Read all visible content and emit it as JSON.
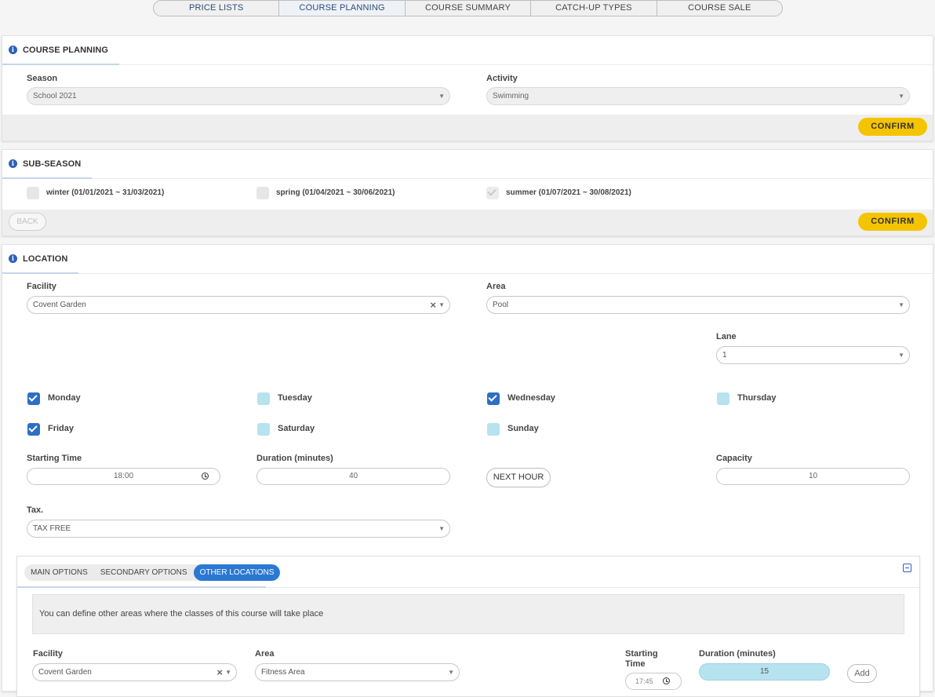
{
  "topnav": {
    "tabs": [
      {
        "label": "PRICE LISTS"
      },
      {
        "label": "COURSE PLANNING"
      },
      {
        "label": "COURSE SUMMARY"
      },
      {
        "label": "CATCH-UP TYPES"
      },
      {
        "label": "COURSE SALE"
      }
    ]
  },
  "course_planning": {
    "title": "COURSE PLANNING",
    "season_label": "Season",
    "season_value": "School 2021",
    "activity_label": "Activity",
    "activity_value": "Swimming",
    "confirm_label": "CONFIRM"
  },
  "sub_season": {
    "title": "SUB-SEASON",
    "items": [
      {
        "label": "winter (01/01/2021 ~ 31/03/2021)"
      },
      {
        "label": "spring (01/04/2021 ~ 30/06/2021)"
      },
      {
        "label": "summer (01/07/2021 ~ 30/08/2021)"
      }
    ],
    "back_label": "BACK",
    "confirm_label": "CONFIRM"
  },
  "location": {
    "title": "LOCATION",
    "facility_label": "Facility",
    "facility_value": "Covent Garden",
    "area_label": "Area",
    "area_value": "Pool",
    "lane_label": "Lane",
    "lane_value": "1",
    "days": {
      "monday": "Monday",
      "tuesday": "Tuesday",
      "wednesday": "Wednesday",
      "thursday": "Thursday",
      "friday": "Friday",
      "saturday": "Saturday",
      "sunday": "Sunday"
    },
    "starting_time_label": "Starting Time",
    "starting_time_value": "18:00",
    "duration_label": "Duration (minutes)",
    "duration_value": "40",
    "next_hour_label": "NEXT HOUR",
    "capacity_label": "Capacity",
    "capacity_value": "10",
    "tax_label": "Tax.",
    "tax_value": "TAX FREE"
  },
  "options": {
    "tabs": [
      {
        "label": "MAIN OPTIONS"
      },
      {
        "label": "SECONDARY OPTIONS"
      },
      {
        "label": "OTHER LOCATIONS"
      }
    ],
    "info_text": "You can define other areas where the classes of this course will take place",
    "facility_label": "Facility",
    "facility_value": "Covent Garden",
    "area_label": "Area",
    "area_value": "Fitness Area",
    "starting_time_label": "Starting Time",
    "starting_time_value": "17:45",
    "duration_label": "Duration (minutes)",
    "duration_value": "15",
    "add_label": "Add"
  },
  "colors": {
    "accent_yellow": "#f5c400",
    "accent_blue": "#2a78d4",
    "checkbox_blue": "#2d6fc5",
    "checkbox_light": "#b6e3ef"
  }
}
